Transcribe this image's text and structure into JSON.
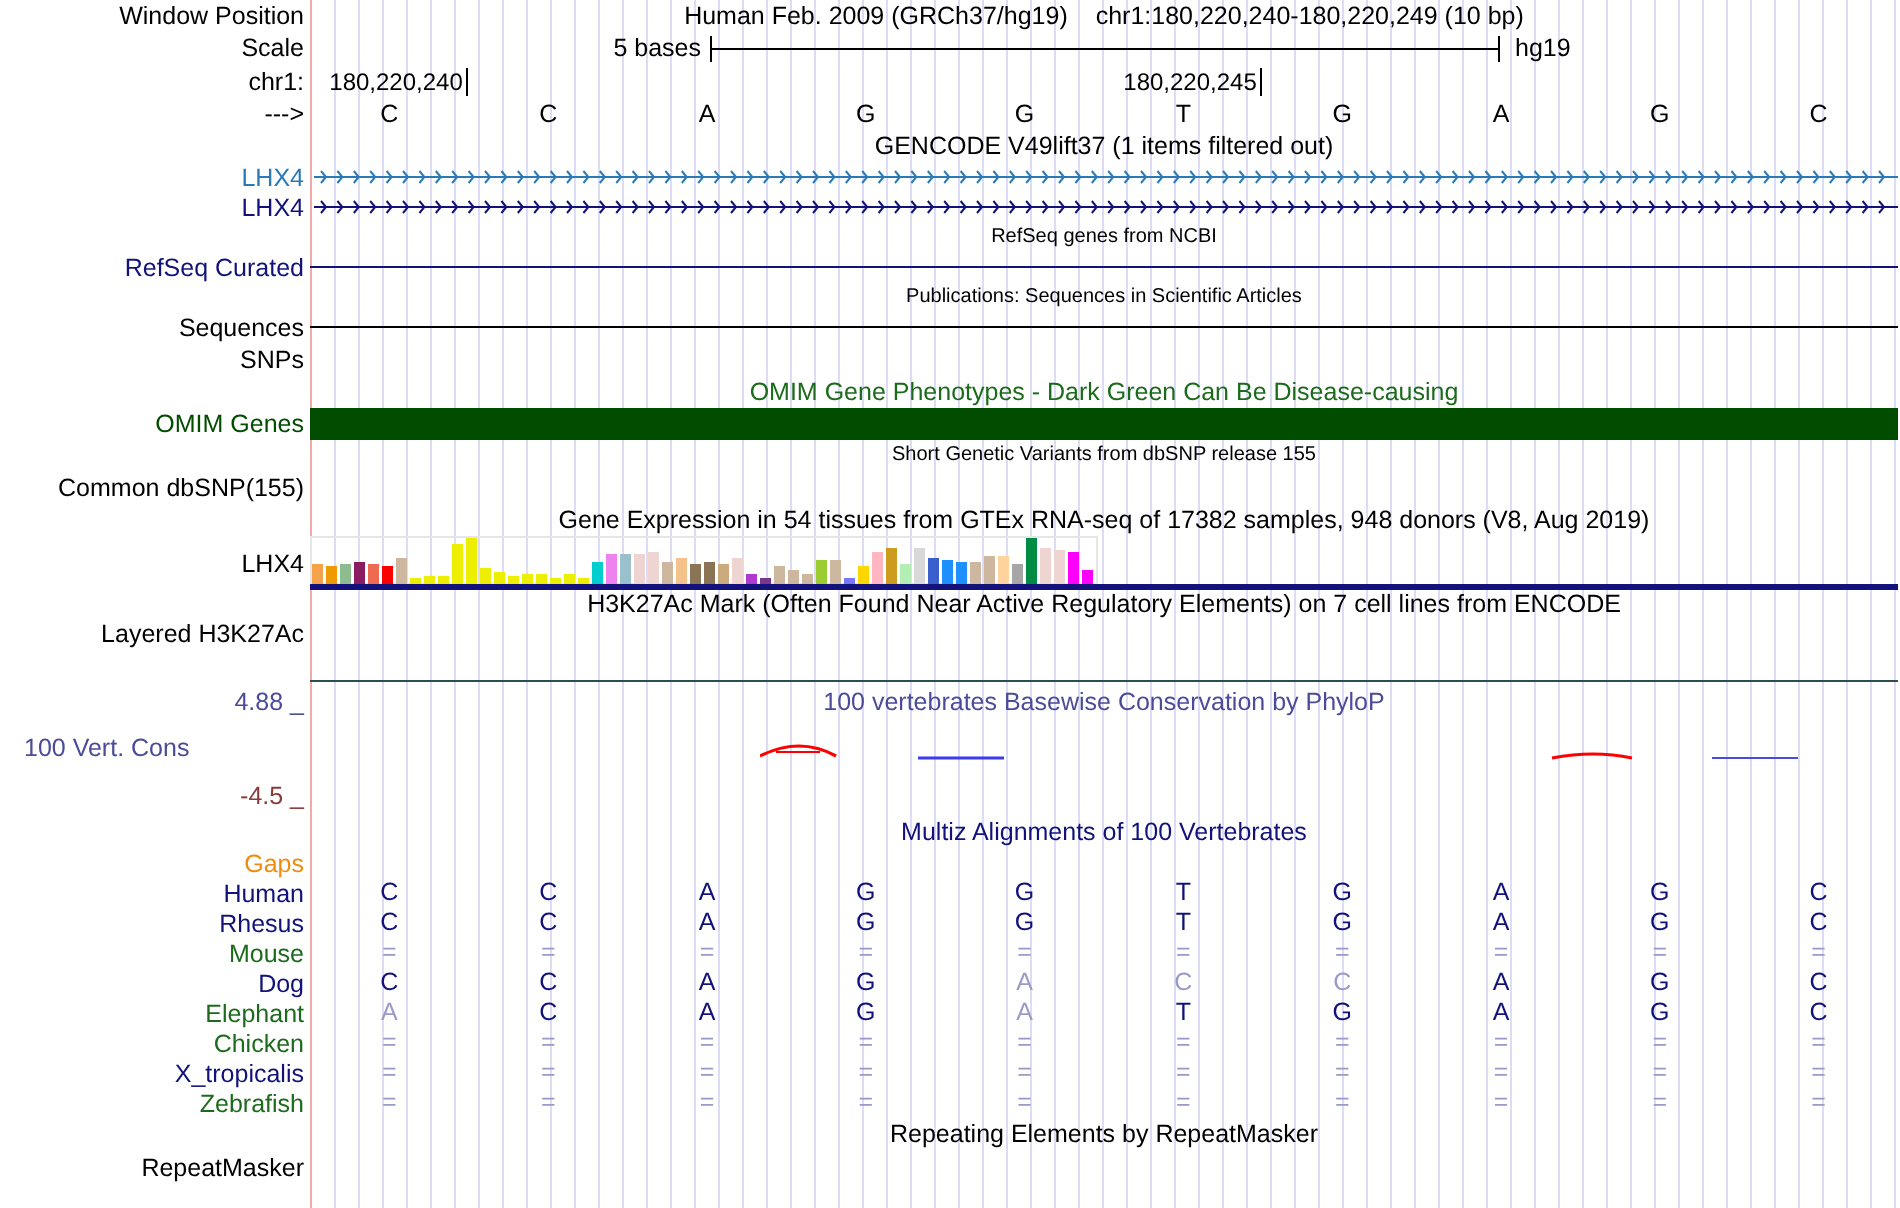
{
  "header": {
    "position_label": "Window Position",
    "assembly": "Human Feb. 2009 (GRCh37/hg19)",
    "position": "chr1:180,220,240-180,220,249 (10 bp)",
    "scale_label": "Scale",
    "scale_text": "5 bases",
    "scale_assembly": "hg19",
    "chrom_label": "chr1:",
    "strand_label": "--->",
    "bases": [
      {
        "base": "C",
        "tick": "180,220,240"
      },
      {
        "base": "C"
      },
      {
        "base": "A"
      },
      {
        "base": "G"
      },
      {
        "base": "G"
      },
      {
        "base": "T",
        "tick": "180,220,245"
      },
      {
        "base": "G"
      },
      {
        "base": "A"
      },
      {
        "base": "G"
      },
      {
        "base": "C"
      }
    ]
  },
  "tracks": [
    {
      "kind": "title",
      "text": "GENCODE V49lift37 (1 items filtered out)",
      "color": "#000000"
    },
    {
      "kind": "gene",
      "label": "LHX4",
      "color": "#2a7ab8"
    },
    {
      "kind": "gene",
      "label": "LHX4",
      "color": "#12127a"
    },
    {
      "kind": "subtitle",
      "text": "RefSeq genes from NCBI"
    },
    {
      "kind": "line",
      "label": "RefSeq Curated",
      "color": "#12127a"
    },
    {
      "kind": "subtitle",
      "text": "Publications: Sequences in Scientific Articles"
    },
    {
      "kind": "line",
      "label": "Sequences",
      "color": "#000000"
    },
    {
      "kind": "empty",
      "label": "SNPs"
    },
    {
      "kind": "title",
      "text": "OMIM Gene Phenotypes - Dark Green Can Be Disease-causing",
      "color": "#1c6b1c"
    },
    {
      "kind": "bar",
      "label": "OMIM Genes",
      "color": "#004d00"
    },
    {
      "kind": "subtitle",
      "text": "Short Genetic Variants from dbSNP release 155"
    },
    {
      "kind": "empty",
      "label": "Common dbSNP(155)"
    },
    {
      "kind": "title",
      "text": "Gene Expression in 54 tissues from GTEx RNA-seq of 17382 samples, 948 donors (V8, Aug 2019)",
      "color": "#000000"
    },
    {
      "kind": "expression",
      "label": "LHX4"
    },
    {
      "kind": "layered",
      "title": "H3K27Ac Mark (Often Found Near Active Regulatory Elements) on 7 cell lines from ENCODE",
      "label": "Layered H3K27Ac"
    },
    {
      "kind": "phylop",
      "max_label": "4.88 _",
      "title": "100 vertebrates Basewise Conservation by PhyloP",
      "label": "100 Vert. Cons",
      "min_label": "-4.5 _"
    },
    {
      "kind": "title",
      "text": "Multiz Alignments of 100 Vertebrates",
      "color": "#12127a"
    },
    {
      "kind": "species",
      "label": "Gaps",
      "color": "#ef8c10"
    },
    {
      "kind": "species",
      "label": "Human",
      "color": "#12127a",
      "bases": [
        {
          "base": "C",
          "faded": false
        },
        {
          "base": "C",
          "faded": false
        },
        {
          "base": "A",
          "faded": false
        },
        {
          "base": "G",
          "faded": false
        },
        {
          "base": "G",
          "faded": false
        },
        {
          "base": "T",
          "faded": false
        },
        {
          "base": "G",
          "faded": false
        },
        {
          "base": "A",
          "faded": false
        },
        {
          "base": "G",
          "faded": false
        },
        {
          "base": "C",
          "faded": false
        }
      ]
    },
    {
      "kind": "species",
      "label": "Rhesus",
      "color": "#12127a",
      "bases": [
        {
          "base": "C",
          "faded": false
        },
        {
          "base": "C",
          "faded": false
        },
        {
          "base": "A",
          "faded": false
        },
        {
          "base": "G",
          "faded": false
        },
        {
          "base": "G",
          "faded": false
        },
        {
          "base": "T",
          "faded": false
        },
        {
          "base": "G",
          "faded": false
        },
        {
          "base": "A",
          "faded": false
        },
        {
          "base": "G",
          "faded": false
        },
        {
          "base": "C",
          "faded": false
        }
      ]
    },
    {
      "kind": "species",
      "label": "Mouse",
      "color": "#1c6b1c",
      "bases": [
        {
          "base": "=",
          "faded": true
        },
        {
          "base": "=",
          "faded": true
        },
        {
          "base": "=",
          "faded": true
        },
        {
          "base": "=",
          "faded": true
        },
        {
          "base": "=",
          "faded": true
        },
        {
          "base": "=",
          "faded": true
        },
        {
          "base": "=",
          "faded": true
        },
        {
          "base": "=",
          "faded": true
        },
        {
          "base": "=",
          "faded": true
        },
        {
          "base": "=",
          "faded": true
        }
      ]
    },
    {
      "kind": "species",
      "label": "Dog",
      "color": "#12127a",
      "bases": [
        {
          "base": "C",
          "faded": false
        },
        {
          "base": "C",
          "faded": false
        },
        {
          "base": "A",
          "faded": false
        },
        {
          "base": "G",
          "faded": false
        },
        {
          "base": "A",
          "faded": true
        },
        {
          "base": "C",
          "faded": true
        },
        {
          "base": "C",
          "faded": true
        },
        {
          "base": "A",
          "faded": false
        },
        {
          "base": "G",
          "faded": false
        },
        {
          "base": "C",
          "faded": false
        }
      ]
    },
    {
      "kind": "species",
      "label": "Elephant",
      "color": "#1c6b1c",
      "bases": [
        {
          "base": "A",
          "faded": true
        },
        {
          "base": "C",
          "faded": false
        },
        {
          "base": "A",
          "faded": false
        },
        {
          "base": "G",
          "faded": false
        },
        {
          "base": "A",
          "faded": true
        },
        {
          "base": "T",
          "faded": false
        },
        {
          "base": "G",
          "faded": false
        },
        {
          "base": "A",
          "faded": false
        },
        {
          "base": "G",
          "faded": false
        },
        {
          "base": "C",
          "faded": false
        }
      ]
    },
    {
      "kind": "species",
      "label": "Chicken",
      "color": "#1c6b1c",
      "bases": [
        {
          "base": "=",
          "faded": true
        },
        {
          "base": "=",
          "faded": true
        },
        {
          "base": "=",
          "faded": true
        },
        {
          "base": "=",
          "faded": true
        },
        {
          "base": "=",
          "faded": true
        },
        {
          "base": "=",
          "faded": true
        },
        {
          "base": "=",
          "faded": true
        },
        {
          "base": "=",
          "faded": true
        },
        {
          "base": "=",
          "faded": true
        },
        {
          "base": "=",
          "faded": true
        }
      ]
    },
    {
      "kind": "species",
      "label": "X_tropicalis",
      "color": "#12127a",
      "bases": [
        {
          "base": "=",
          "faded": true
        },
        {
          "base": "=",
          "faded": true
        },
        {
          "base": "=",
          "faded": true
        },
        {
          "base": "=",
          "faded": true
        },
        {
          "base": "=",
          "faded": true
        },
        {
          "base": "=",
          "faded": true
        },
        {
          "base": "=",
          "faded": true
        },
        {
          "base": "=",
          "faded": true
        },
        {
          "base": "=",
          "faded": true
        },
        {
          "base": "=",
          "faded": true
        }
      ]
    },
    {
      "kind": "species",
      "label": "Zebrafish",
      "color": "#1c6b1c",
      "bases": [
        {
          "base": "=",
          "faded": true
        },
        {
          "base": "=",
          "faded": true
        },
        {
          "base": "=",
          "faded": true
        },
        {
          "base": "=",
          "faded": true
        },
        {
          "base": "=",
          "faded": true
        },
        {
          "base": "=",
          "faded": true
        },
        {
          "base": "=",
          "faded": true
        },
        {
          "base": "=",
          "faded": true
        },
        {
          "base": "=",
          "faded": true
        },
        {
          "base": "=",
          "faded": true
        }
      ]
    },
    {
      "kind": "title",
      "text": "Repeating Elements by RepeatMasker",
      "color": "#000000"
    },
    {
      "kind": "empty",
      "label": "RepeatMasker"
    }
  ]
}
